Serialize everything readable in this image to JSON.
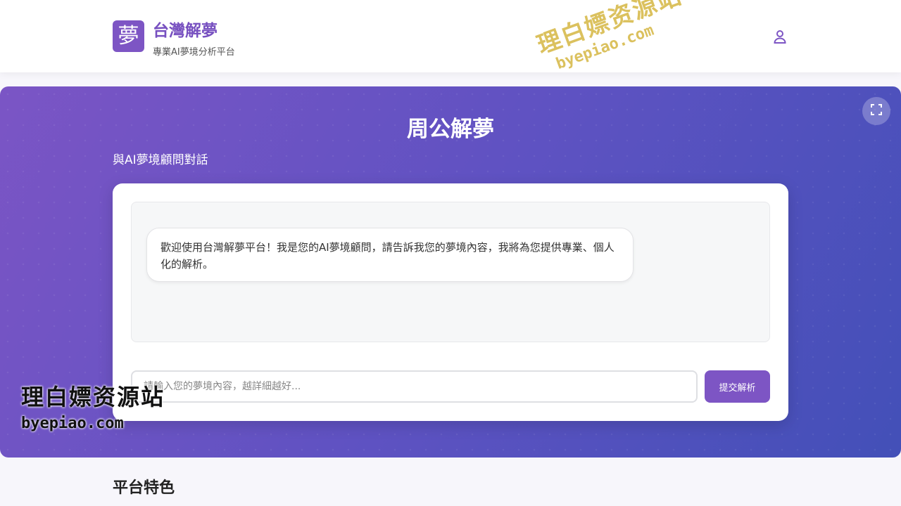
{
  "header": {
    "logo_char": "夢",
    "title": "台灣解夢",
    "subtitle": "專業AI夢境分析平台",
    "user_icon": "user-icon"
  },
  "hero": {
    "title": "周公解夢",
    "subtitle": "與AI夢境顧問對話",
    "fullscreen_icon": "fullscreen-icon",
    "chat": {
      "messages": [
        {
          "role": "assistant",
          "text": "歡迎使用台灣解夢平台！我是您的AI夢境顧問，請告訴我您的夢境內容，我將為您提供專業、個人化的解析。"
        }
      ],
      "input_placeholder": "請輸入您的夢境內容，越詳細越好...",
      "input_value": "",
      "submit_label": "提交解析"
    }
  },
  "features": {
    "title": "平台特色"
  },
  "watermarks": {
    "top": {
      "cn": "理白嫖资源站",
      "en": "byepiao.com"
    },
    "bottom": {
      "cn": "理白嫖资源站",
      "en": "byepiao.com"
    }
  },
  "colors": {
    "brand": "#7d55c4",
    "hero_gradient_start": "#7b55c5",
    "hero_gradient_end": "#4350b8"
  }
}
